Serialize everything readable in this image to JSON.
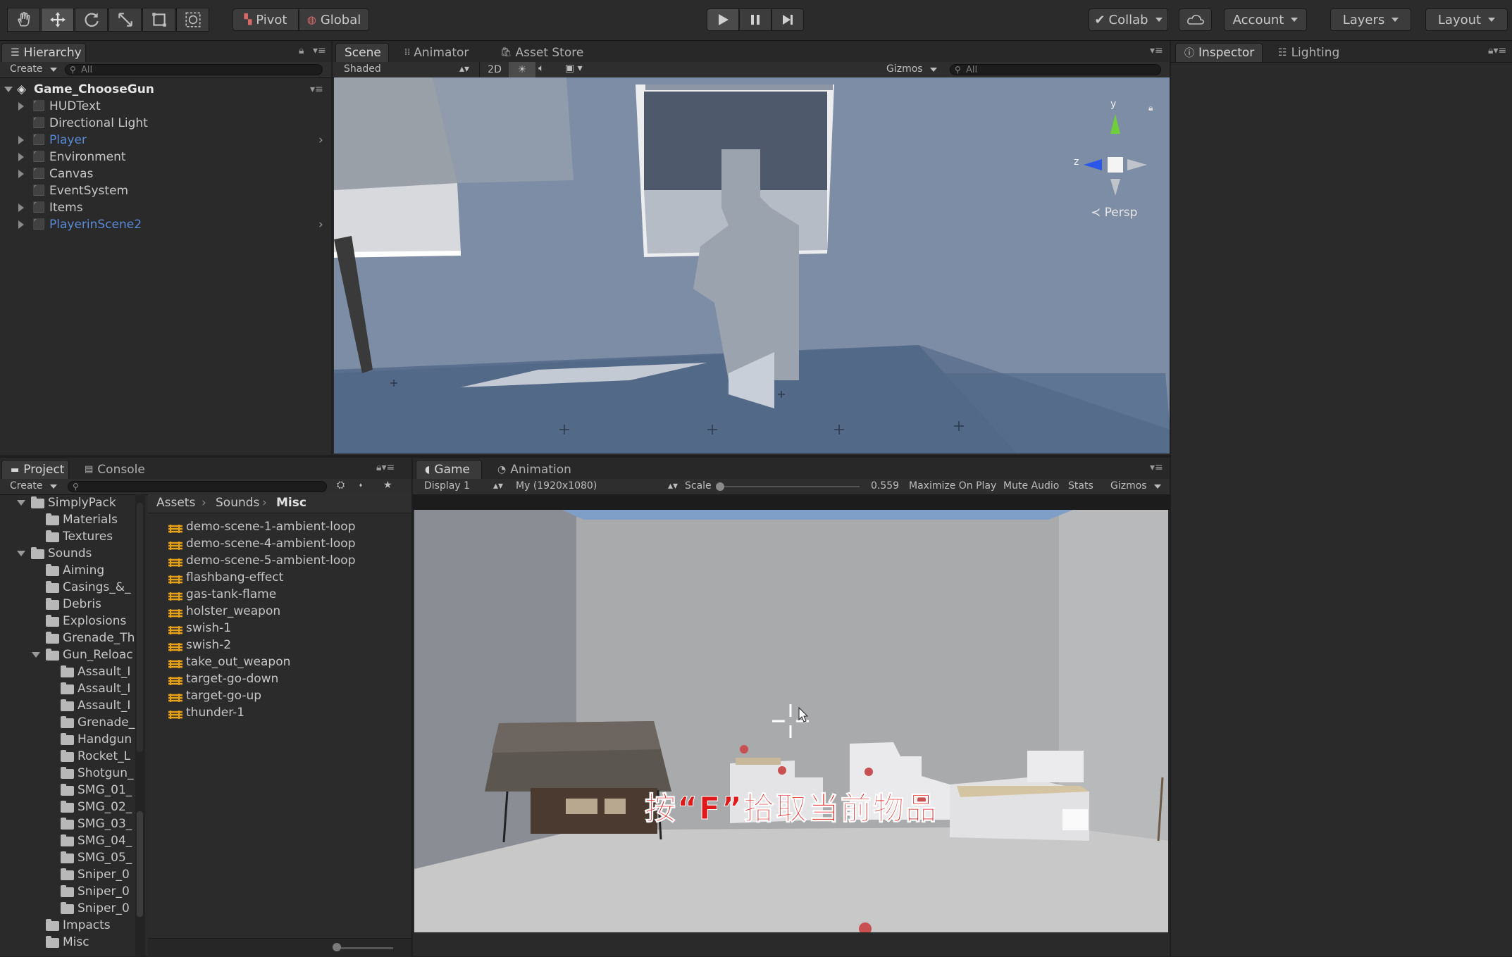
{
  "toolbar": {
    "pivot": "Pivot",
    "global": "Global",
    "collab": "Collab",
    "account": "Account",
    "layers": "Layers",
    "layout": "Layout"
  },
  "hierarchy": {
    "tab": "Hierarchy",
    "create": "Create",
    "search_placeholder": "All",
    "scene_name": "Game_ChooseGun",
    "items": [
      {
        "label": "HUDText"
      },
      {
        "label": "Directional Light"
      },
      {
        "label": "Player"
      },
      {
        "label": "Environment"
      },
      {
        "label": "Canvas"
      },
      {
        "label": "EventSystem"
      },
      {
        "label": "Items"
      },
      {
        "label": "PlayerinScene2"
      }
    ]
  },
  "scene": {
    "tabs": [
      "Scene",
      "Animator",
      "Asset Store"
    ],
    "shading": "Shaded",
    "mode_2d": "2D",
    "gizmos": "Gizmos",
    "search_placeholder": "All",
    "persp": "Persp",
    "axis_y": "y",
    "axis_z": "z"
  },
  "inspector": {
    "tabs": [
      "Inspector",
      "Lighting"
    ]
  },
  "project": {
    "tabs": [
      "Project",
      "Console"
    ],
    "create": "Create",
    "breadcrumb": [
      "Assets",
      "Sounds",
      "Misc"
    ],
    "tree": [
      {
        "label": "SimplyPack"
      },
      {
        "label": "Materials"
      },
      {
        "label": "Textures"
      },
      {
        "label": "Sounds"
      },
      {
        "label": "Aiming"
      },
      {
        "label": "Casings_&_"
      },
      {
        "label": "Debris"
      },
      {
        "label": "Explosions"
      },
      {
        "label": "Grenade_Th"
      },
      {
        "label": "Gun_Reloac"
      },
      {
        "label": "Assault_I"
      },
      {
        "label": "Assault_I"
      },
      {
        "label": "Assault_I"
      },
      {
        "label": "Grenade_"
      },
      {
        "label": "Handgun"
      },
      {
        "label": "Rocket_L"
      },
      {
        "label": "Shotgun_"
      },
      {
        "label": "SMG_01_"
      },
      {
        "label": "SMG_02_"
      },
      {
        "label": "SMG_03_"
      },
      {
        "label": "SMG_04_"
      },
      {
        "label": "SMG_05_"
      },
      {
        "label": "Sniper_0"
      },
      {
        "label": "Sniper_0"
      },
      {
        "label": "Sniper_0"
      },
      {
        "label": "Impacts"
      },
      {
        "label": "Misc"
      }
    ],
    "assets": [
      "demo-scene-1-ambient-loop",
      "demo-scene-4-ambient-loop",
      "demo-scene-5-ambient-loop",
      "flashbang-effect",
      "gas-tank-flame",
      "holster_weapon",
      "swish-1",
      "swish-2",
      "take_out_weapon",
      "target-go-down",
      "target-go-up",
      "thunder-1"
    ]
  },
  "game": {
    "tabs": [
      "Game",
      "Animation"
    ],
    "display": "Display 1",
    "resolution": "My (1920x1080)",
    "scale_label": "Scale",
    "scale_value": "0.559",
    "maximize": "Maximize On Play",
    "mute": "Mute Audio",
    "stats": "Stats",
    "gizmos": "Gizmos",
    "hud_text": "按“F”拾取当前物品"
  },
  "colors": {
    "accent_blue": "#5a8ad6",
    "hud_red": "#e01a1a",
    "audio_orange": "#e8a21a"
  }
}
